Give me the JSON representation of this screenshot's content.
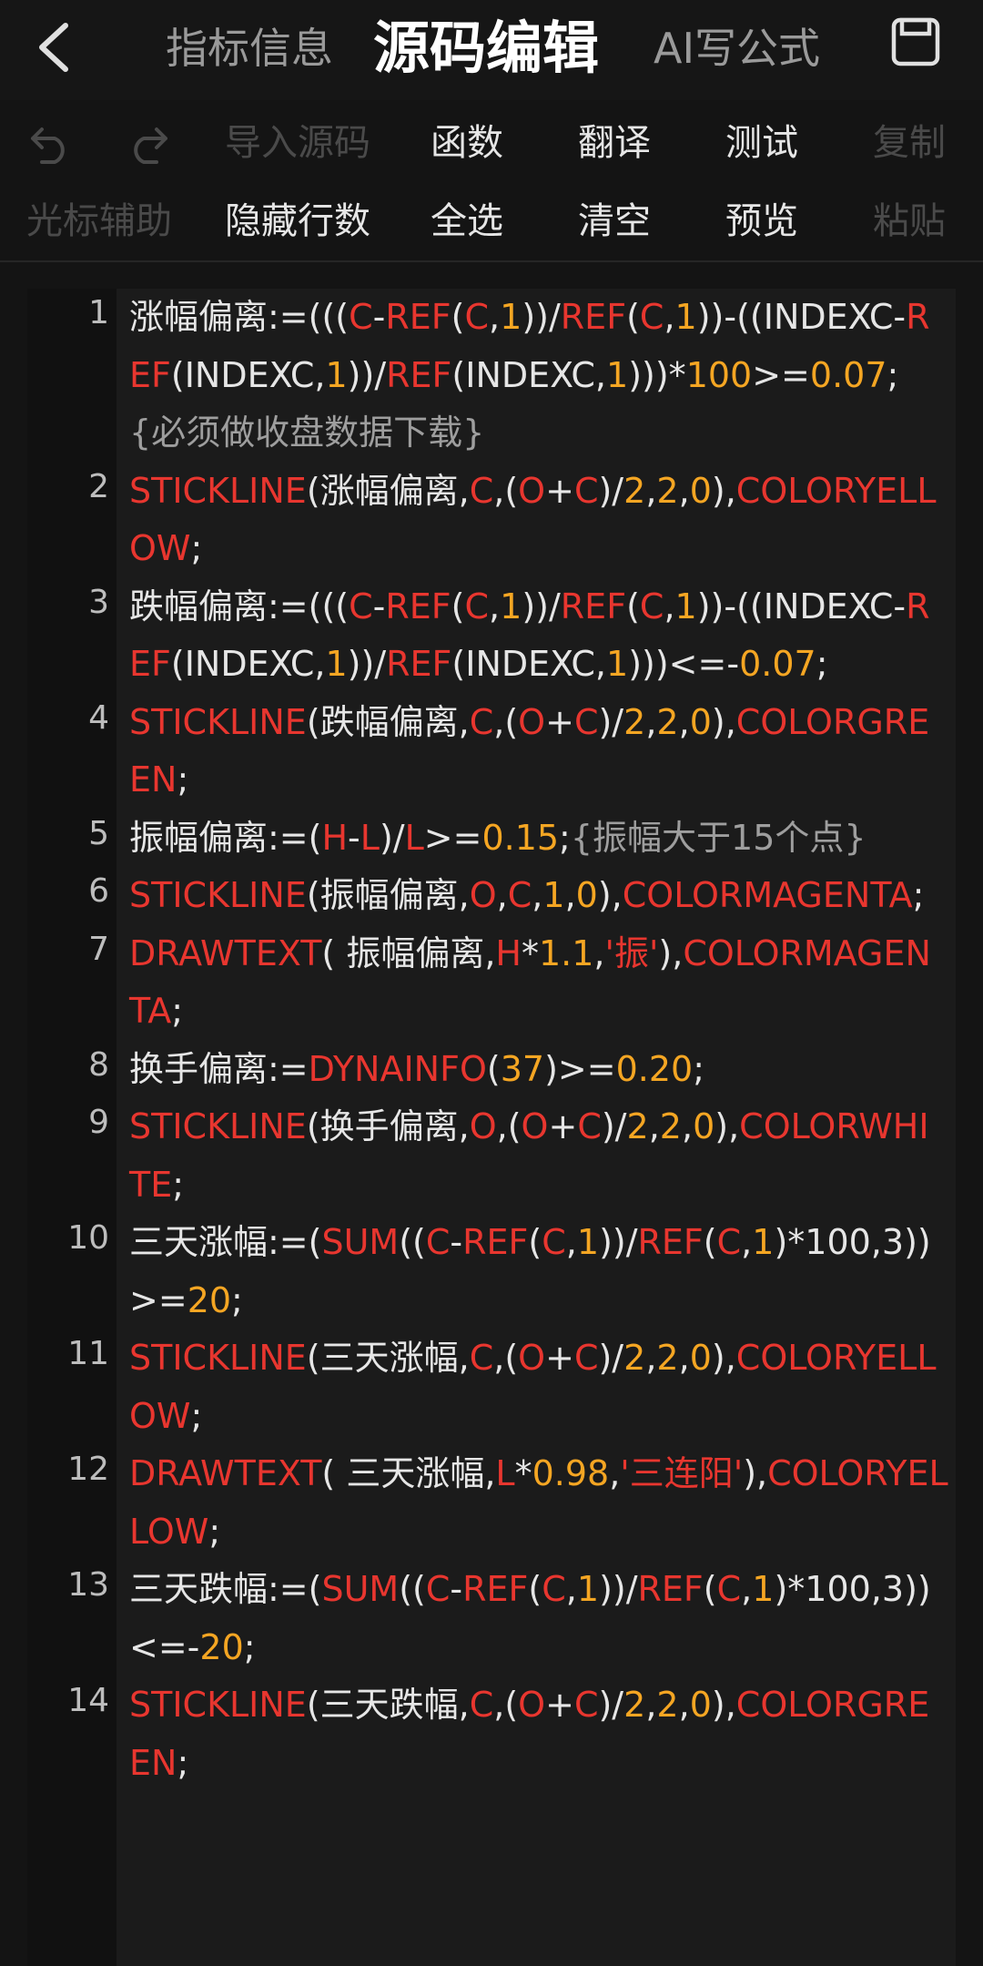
{
  "header": {
    "tabs": [
      {
        "label": "指标信息",
        "active": false
      },
      {
        "label": "源码编辑",
        "active": true
      },
      {
        "label": "AI写公式",
        "active": false
      }
    ],
    "back_icon": "chevron-left-icon",
    "save_icon": "save-icon"
  },
  "toolbar": {
    "row1": [
      {
        "label": "",
        "icon": "undo-icon",
        "enabled": false
      },
      {
        "label": "",
        "icon": "redo-icon",
        "enabled": false
      },
      {
        "label": "导入源码",
        "enabled": false
      },
      {
        "label": "函数",
        "enabled": true
      },
      {
        "label": "翻译",
        "enabled": true
      },
      {
        "label": "测试",
        "enabled": true
      },
      {
        "label": "复制",
        "enabled": false
      }
    ],
    "row2": [
      {
        "label": "光标辅助",
        "enabled": false
      },
      {
        "label": "隐藏行数",
        "enabled": true
      },
      {
        "label": "全选",
        "enabled": true
      },
      {
        "label": "清空",
        "enabled": true
      },
      {
        "label": "预览",
        "enabled": true
      },
      {
        "label": "粘贴",
        "enabled": false
      }
    ]
  },
  "colors": {
    "default": "#e6e6e6",
    "function": "#e8362f",
    "number": "#f5a623",
    "comment": "#9e9e9e"
  },
  "editor": {
    "lines": [
      {
        "n": "1",
        "tokens": [
          [
            "涨幅偏离:=(((",
            "d"
          ],
          [
            "C",
            "f"
          ],
          [
            "-",
            "d"
          ],
          [
            "REF",
            "f"
          ],
          [
            "(",
            "d"
          ],
          [
            "C",
            "f"
          ],
          [
            ",",
            "d"
          ],
          [
            "1",
            "n"
          ],
          [
            "))/",
            "d"
          ],
          [
            "REF",
            "f"
          ],
          [
            "(",
            "d"
          ],
          [
            "C",
            "f"
          ],
          [
            ",",
            "d"
          ],
          [
            "1",
            "n"
          ],
          [
            "))-((INDEXC-",
            "d"
          ],
          [
            "REF",
            "f"
          ],
          [
            "(INDEXC,",
            "d"
          ],
          [
            "1",
            "n"
          ],
          [
            "))/",
            "d"
          ],
          [
            "REF",
            "f"
          ],
          [
            "(INDEXC,",
            "d"
          ],
          [
            "1",
            "n"
          ],
          [
            ")))*",
            "d"
          ],
          [
            "100",
            "n"
          ],
          [
            ">=",
            "d"
          ],
          [
            "0.07",
            "n"
          ],
          [
            ";",
            "d"
          ],
          [
            "{必须做收盘数据下载}",
            "c"
          ]
        ]
      },
      {
        "n": "2",
        "tokens": [
          [
            "STICKLINE",
            "f"
          ],
          [
            "(涨幅偏离,",
            "d"
          ],
          [
            "C",
            "f"
          ],
          [
            ",(",
            "d"
          ],
          [
            "O",
            "f"
          ],
          [
            "+",
            "d"
          ],
          [
            "C",
            "f"
          ],
          [
            ")/",
            "d"
          ],
          [
            "2",
            "n"
          ],
          [
            ",",
            "d"
          ],
          [
            "2",
            "n"
          ],
          [
            ",",
            "d"
          ],
          [
            "0",
            "n"
          ],
          [
            "),",
            "d"
          ],
          [
            "COLORYELLOW",
            "f"
          ],
          [
            ";",
            "d"
          ]
        ]
      },
      {
        "n": "3",
        "tokens": [
          [
            "跌幅偏离:=(((",
            "d"
          ],
          [
            "C",
            "f"
          ],
          [
            "-",
            "d"
          ],
          [
            "REF",
            "f"
          ],
          [
            "(",
            "d"
          ],
          [
            "C",
            "f"
          ],
          [
            ",",
            "d"
          ],
          [
            "1",
            "n"
          ],
          [
            "))/",
            "d"
          ],
          [
            "REF",
            "f"
          ],
          [
            "(",
            "d"
          ],
          [
            "C",
            "f"
          ],
          [
            ",",
            "d"
          ],
          [
            "1",
            "n"
          ],
          [
            "))-((INDEXC-",
            "d"
          ],
          [
            "REF",
            "f"
          ],
          [
            "(INDEXC,",
            "d"
          ],
          [
            "1",
            "n"
          ],
          [
            "))/",
            "d"
          ],
          [
            "REF",
            "f"
          ],
          [
            "(INDEXC,",
            "d"
          ],
          [
            "1",
            "n"
          ],
          [
            ")))<=-",
            "d"
          ],
          [
            "0.07",
            "n"
          ],
          [
            ";",
            "d"
          ]
        ]
      },
      {
        "n": "4",
        "tokens": [
          [
            "STICKLINE",
            "f"
          ],
          [
            "(跌幅偏离,",
            "d"
          ],
          [
            "C",
            "f"
          ],
          [
            ",(",
            "d"
          ],
          [
            "O",
            "f"
          ],
          [
            "+",
            "d"
          ],
          [
            "C",
            "f"
          ],
          [
            ")/",
            "d"
          ],
          [
            "2",
            "n"
          ],
          [
            ",",
            "d"
          ],
          [
            "2",
            "n"
          ],
          [
            ",",
            "d"
          ],
          [
            "0",
            "n"
          ],
          [
            "),",
            "d"
          ],
          [
            "COLORGREEN",
            "f"
          ],
          [
            ";",
            "d"
          ]
        ]
      },
      {
        "n": "5",
        "tokens": [
          [
            "振幅偏离:=(",
            "d"
          ],
          [
            "H",
            "f"
          ],
          [
            "-",
            "d"
          ],
          [
            "L",
            "f"
          ],
          [
            ")/",
            "d"
          ],
          [
            "L",
            "f"
          ],
          [
            ">=",
            "d"
          ],
          [
            "0.15",
            "n"
          ],
          [
            ";",
            "d"
          ],
          [
            "{振幅大于15个点}",
            "c"
          ]
        ]
      },
      {
        "n": "6",
        "tokens": [
          [
            "STICKLINE",
            "f"
          ],
          [
            "(振幅偏离,",
            "d"
          ],
          [
            "O",
            "f"
          ],
          [
            ",",
            "d"
          ],
          [
            "C",
            "f"
          ],
          [
            ",",
            "d"
          ],
          [
            "1",
            "n"
          ],
          [
            ",",
            "d"
          ],
          [
            "0",
            "n"
          ],
          [
            "),",
            "d"
          ],
          [
            "COLORMAGENTA",
            "f"
          ],
          [
            ";",
            "d"
          ]
        ]
      },
      {
        "n": "7",
        "tokens": [
          [
            "DRAWTEXT",
            "f"
          ],
          [
            "( 振幅偏离,",
            "d"
          ],
          [
            "H",
            "f"
          ],
          [
            "*",
            "d"
          ],
          [
            "1.1",
            "n"
          ],
          [
            ",",
            "d"
          ],
          [
            "'振'",
            "s"
          ],
          [
            "),",
            "d"
          ],
          [
            "COLORMAGENTA",
            "f"
          ],
          [
            ";",
            "d"
          ]
        ]
      },
      {
        "n": "8",
        "tokens": [
          [
            "换手偏离:=",
            "d"
          ],
          [
            "DYNAINFO",
            "f"
          ],
          [
            "(",
            "d"
          ],
          [
            "37",
            "n"
          ],
          [
            ")>=",
            "d"
          ],
          [
            "0.20",
            "n"
          ],
          [
            ";",
            "d"
          ]
        ]
      },
      {
        "n": "9",
        "tokens": [
          [
            "STICKLINE",
            "f"
          ],
          [
            "(换手偏离,",
            "d"
          ],
          [
            "O",
            "f"
          ],
          [
            ",(",
            "d"
          ],
          [
            "O",
            "f"
          ],
          [
            "+",
            "d"
          ],
          [
            "C",
            "f"
          ],
          [
            ")/",
            "d"
          ],
          [
            "2",
            "n"
          ],
          [
            ",",
            "d"
          ],
          [
            "2",
            "n"
          ],
          [
            ",",
            "d"
          ],
          [
            "0",
            "n"
          ],
          [
            "),",
            "d"
          ],
          [
            "COLORWHITE",
            "f"
          ],
          [
            ";",
            "d"
          ]
        ]
      },
      {
        "n": "10",
        "tokens": [
          [
            "三天涨幅:=(",
            "d"
          ],
          [
            "SUM",
            "f"
          ],
          [
            "((",
            "d"
          ],
          [
            "C",
            "f"
          ],
          [
            "-",
            "d"
          ],
          [
            "REF",
            "f"
          ],
          [
            "(",
            "d"
          ],
          [
            "C",
            "f"
          ],
          [
            ",",
            "d"
          ],
          [
            "1",
            "n"
          ],
          [
            "))/",
            "d"
          ],
          [
            "REF",
            "f"
          ],
          [
            "(",
            "d"
          ],
          [
            "C",
            "f"
          ],
          [
            ",",
            "d"
          ],
          [
            "1",
            "n"
          ],
          [
            ")*100,3))>=",
            "d"
          ],
          [
            "20",
            "n"
          ],
          [
            ";",
            "d"
          ]
        ]
      },
      {
        "n": "11",
        "tokens": [
          [
            "STICKLINE",
            "f"
          ],
          [
            "(三天涨幅,",
            "d"
          ],
          [
            "C",
            "f"
          ],
          [
            ",(",
            "d"
          ],
          [
            "O",
            "f"
          ],
          [
            "+",
            "d"
          ],
          [
            "C",
            "f"
          ],
          [
            ")/",
            "d"
          ],
          [
            "2",
            "n"
          ],
          [
            ",",
            "d"
          ],
          [
            "2",
            "n"
          ],
          [
            ",",
            "d"
          ],
          [
            "0",
            "n"
          ],
          [
            "),",
            "d"
          ],
          [
            "COLORYELLOW",
            "f"
          ],
          [
            ";",
            "d"
          ]
        ]
      },
      {
        "n": "12",
        "tokens": [
          [
            "DRAWTEXT",
            "f"
          ],
          [
            "( 三天涨幅,",
            "d"
          ],
          [
            "L",
            "f"
          ],
          [
            "*",
            "d"
          ],
          [
            "0.98",
            "n"
          ],
          [
            ",",
            "d"
          ],
          [
            "'三连阳'",
            "s"
          ],
          [
            "),",
            "d"
          ],
          [
            "COLORYELLOW",
            "f"
          ],
          [
            ";",
            "d"
          ]
        ]
      },
      {
        "n": "13",
        "tokens": [
          [
            "三天跌幅:=(",
            "d"
          ],
          [
            "SUM",
            "f"
          ],
          [
            "((",
            "d"
          ],
          [
            "C",
            "f"
          ],
          [
            "-",
            "d"
          ],
          [
            "REF",
            "f"
          ],
          [
            "(",
            "d"
          ],
          [
            "C",
            "f"
          ],
          [
            ",",
            "d"
          ],
          [
            "1",
            "n"
          ],
          [
            "))/",
            "d"
          ],
          [
            "REF",
            "f"
          ],
          [
            "(",
            "d"
          ],
          [
            "C",
            "f"
          ],
          [
            ",",
            "d"
          ],
          [
            "1",
            "n"
          ],
          [
            ")*100,3))<=-",
            "d"
          ],
          [
            "20",
            "n"
          ],
          [
            ";",
            "d"
          ]
        ]
      },
      {
        "n": "14",
        "tokens": [
          [
            "STICKLINE",
            "f"
          ],
          [
            "(三天跌幅,",
            "d"
          ],
          [
            "C",
            "f"
          ],
          [
            ",(",
            "d"
          ],
          [
            "O",
            "f"
          ],
          [
            "+",
            "d"
          ],
          [
            "C",
            "f"
          ],
          [
            ")/",
            "d"
          ],
          [
            "2",
            "n"
          ],
          [
            ",",
            "d"
          ],
          [
            "2",
            "n"
          ],
          [
            ",",
            "d"
          ],
          [
            "0",
            "n"
          ],
          [
            "),",
            "d"
          ],
          [
            "COLORGREEN",
            "f"
          ],
          [
            ";",
            "d"
          ]
        ]
      }
    ]
  }
}
